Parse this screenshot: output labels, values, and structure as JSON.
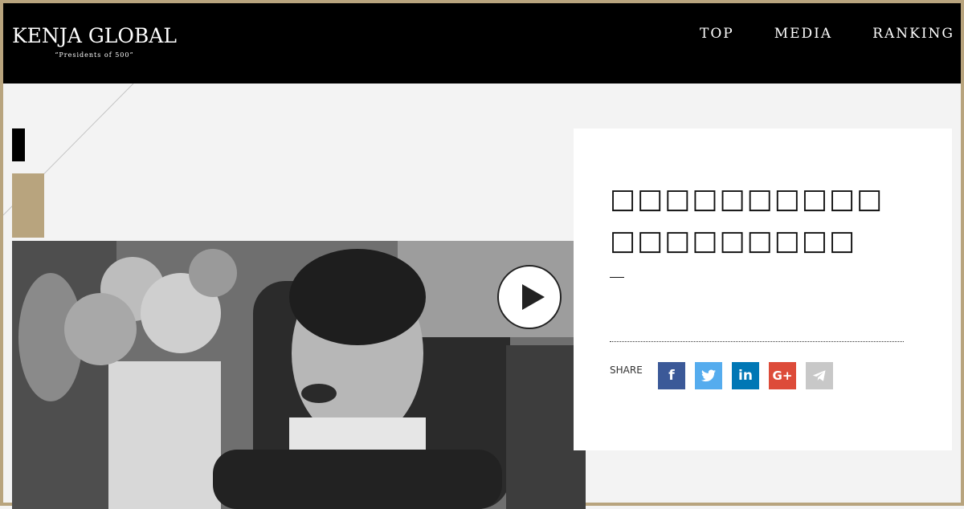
{
  "header": {
    "logo_main": "KENJA GLOBAL",
    "logo_sub": "“Presidents of 500”",
    "nav": [
      "TOP",
      "MEDIA",
      "RANKING"
    ]
  },
  "article": {
    "title": "□□□□□□□□□□□□□□□□□□□",
    "share_label": "SHARE"
  },
  "share_buttons": [
    {
      "icon": "facebook-icon",
      "glyph": "f",
      "color": "#3b5998"
    },
    {
      "icon": "twitter-icon",
      "glyph": "",
      "color": "#55acee"
    },
    {
      "icon": "linkedin-icon",
      "glyph": "in",
      "color": "#0077b5"
    },
    {
      "icon": "google-plus-icon",
      "glyph": "G+",
      "color": "#dd4b39"
    },
    {
      "icon": "telegram-icon",
      "glyph": "",
      "color": "#c8c8c8"
    }
  ],
  "colors": {
    "border": "#b8a47e",
    "header_bg": "#000000",
    "accent_gold": "#b8a47e",
    "page_bg": "#f3f3f3"
  }
}
